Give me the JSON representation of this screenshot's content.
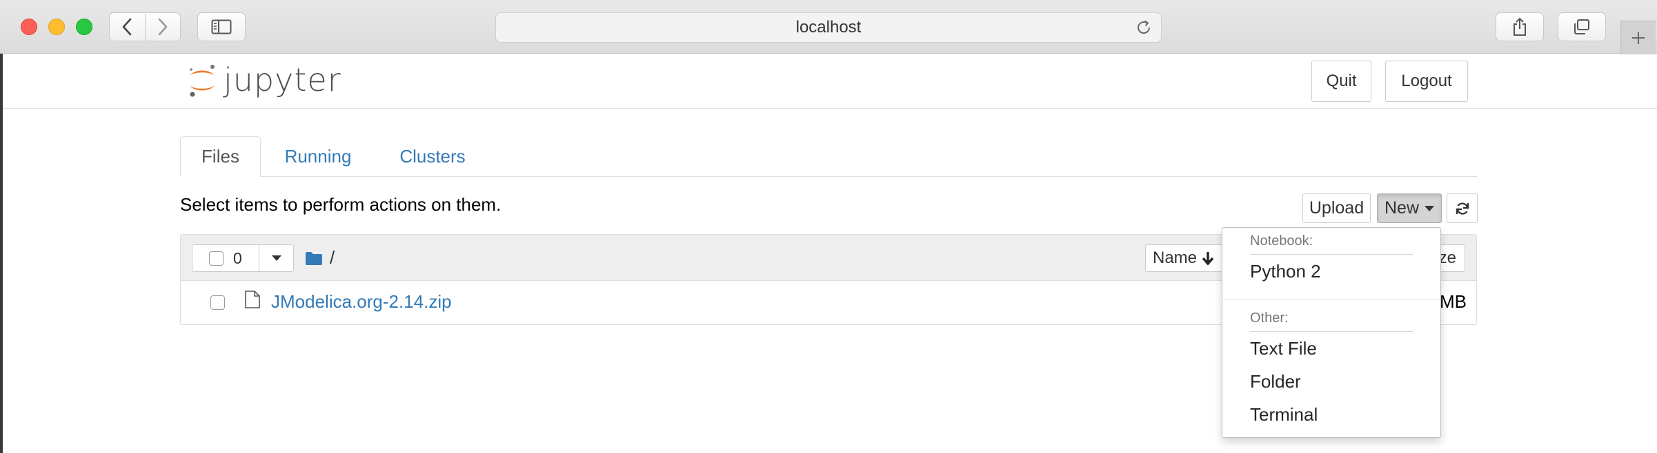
{
  "browser": {
    "address": "localhost"
  },
  "header": {
    "logo_text": "jupyter",
    "quit_label": "Quit",
    "logout_label": "Logout"
  },
  "tabs": [
    {
      "label": "Files",
      "active": true
    },
    {
      "label": "Running",
      "active": false
    },
    {
      "label": "Clusters",
      "active": false
    }
  ],
  "toolbar": {
    "instruction": "Select items to perform actions on them.",
    "upload_label": "Upload",
    "new_label": "New"
  },
  "file_list": {
    "selected_count": "0",
    "breadcrumb": "/",
    "sort_label": "Name",
    "size_header": "ze",
    "rows": [
      {
        "name": "JModelica.org-2.14.zip",
        "size_visible": "MB"
      }
    ]
  },
  "new_menu": {
    "notebook_header": "Notebook:",
    "notebook_items": [
      "Python 2"
    ],
    "other_header": "Other:",
    "other_items": [
      "Text File",
      "Folder",
      "Terminal"
    ]
  },
  "colors": {
    "link": "#337ab7",
    "jupyter_orange": "#f37726"
  }
}
